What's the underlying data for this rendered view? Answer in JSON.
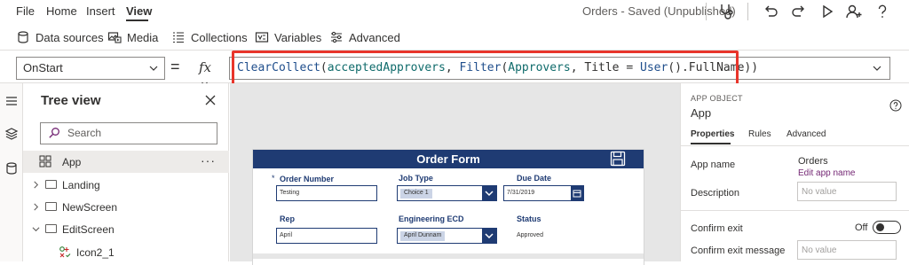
{
  "menu": {
    "items": [
      {
        "label": "File"
      },
      {
        "label": "Home"
      },
      {
        "label": "Insert"
      },
      {
        "label": "View"
      }
    ],
    "document_title": "Orders - Saved (Unpublished)",
    "toolbar_icons": [
      "stethoscope-icon",
      "undo-icon",
      "redo-icon",
      "play-icon",
      "share-user-icon",
      "help-icon"
    ]
  },
  "ribbon": {
    "items": [
      {
        "label": "Data sources",
        "icon": "database-icon"
      },
      {
        "label": "Media",
        "icon": "media-icon"
      },
      {
        "label": "Collections",
        "icon": "collections-icon"
      },
      {
        "label": "Variables",
        "icon": "variables-icon"
      },
      {
        "label": "Advanced",
        "icon": "advanced-icon"
      }
    ]
  },
  "formula_bar": {
    "property": "OnStart",
    "equals": "=",
    "fx": "fx",
    "tokens": [
      {
        "text": "ClearCollect",
        "kind": "fn"
      },
      {
        "text": "(",
        "kind": "plain"
      },
      {
        "text": "acceptedApprovers",
        "kind": "ident"
      },
      {
        "text": ", ",
        "kind": "plain"
      },
      {
        "text": "Filter",
        "kind": "fn"
      },
      {
        "text": "(",
        "kind": "plain"
      },
      {
        "text": "Approvers",
        "kind": "ident"
      },
      {
        "text": ", ",
        "kind": "plain"
      },
      {
        "text": "Title",
        "kind": "plain"
      },
      {
        "text": " = ",
        "kind": "plain"
      },
      {
        "text": "User",
        "kind": "fn"
      },
      {
        "text": "().",
        "kind": "plain"
      },
      {
        "text": "FullName",
        "kind": "plain"
      },
      {
        "text": "))",
        "kind": "plain"
      }
    ],
    "highlight_color": "#e8352b"
  },
  "tree": {
    "title": "Tree view",
    "search_placeholder": "Search",
    "more": "···",
    "items": [
      {
        "label": "App",
        "selected": true
      },
      {
        "label": "Landing"
      },
      {
        "label": "NewScreen"
      },
      {
        "label": "EditScreen"
      },
      {
        "label": "Icon2_1"
      }
    ]
  },
  "form": {
    "title": "Order Form",
    "header_color": "#1f3b73",
    "required_mark": "*",
    "order_number": {
      "label": "Order Number",
      "value": "Testing"
    },
    "job_type": {
      "label": "Job Type",
      "value": "Choice 1"
    },
    "due_date": {
      "label": "Due Date",
      "value": "7/31/2019"
    },
    "rep": {
      "label": "Rep",
      "value": "April"
    },
    "engineering_ecd": {
      "label": "Engineering ECD",
      "value": "April Dunnam"
    },
    "status": {
      "label": "Status",
      "value": "Approved"
    }
  },
  "props": {
    "kind": "APP OBJECT",
    "name": "App",
    "tabs": [
      {
        "label": "Properties",
        "active": true
      },
      {
        "label": "Rules"
      },
      {
        "label": "Advanced"
      }
    ],
    "app_name_label": "App name",
    "app_name_value": "Orders",
    "app_name_link": "Edit app name",
    "description_label": "Description",
    "description_placeholder": "No value",
    "confirm_exit_label": "Confirm exit",
    "confirm_exit_state": "Off",
    "confirm_exit_message_label": "Confirm exit message",
    "confirm_exit_message_placeholder": "No value"
  }
}
